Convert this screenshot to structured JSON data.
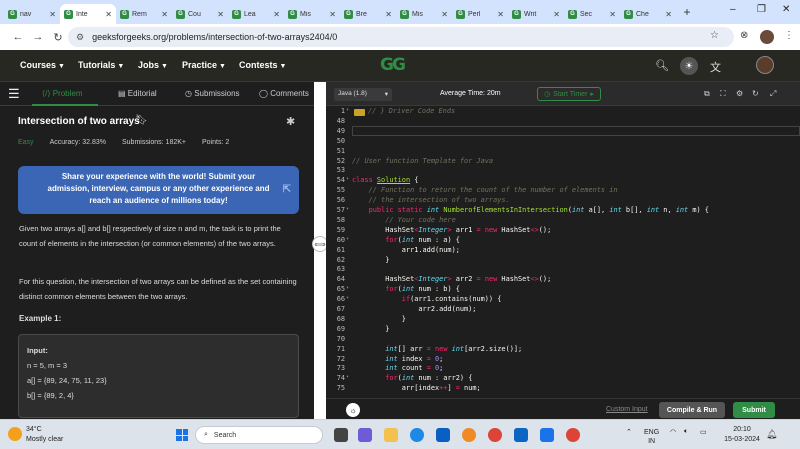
{
  "browser": {
    "tabs": [
      {
        "label": "nav"
      },
      {
        "label": "Inte",
        "active": true
      },
      {
        "label": "Rem"
      },
      {
        "label": "Cou"
      },
      {
        "label": "Lea"
      },
      {
        "label": "Mis"
      },
      {
        "label": "Bre"
      },
      {
        "label": "Mis"
      },
      {
        "label": "Perl"
      },
      {
        "label": "Writ"
      },
      {
        "label": "Sec"
      },
      {
        "label": "Che"
      }
    ],
    "url": "geeksforgeeks.org/problems/intersection-of-two-arrays2404/0"
  },
  "site_nav": {
    "items": [
      "Courses",
      "Tutorials",
      "Jobs",
      "Practice",
      "Contests"
    ],
    "logo": "GG"
  },
  "problem": {
    "tabs": [
      "Problem",
      "Editorial",
      "Submissions",
      "Comments"
    ],
    "title": "Intersection of two arrays",
    "difficulty": "Easy",
    "accuracy": "Accuracy: 32.83%",
    "submissions": "Submissions: 182K+",
    "points": "Points: 2",
    "banner": "Share your experience with the world! Submit your admission, interview, campus or any other experience and reach an audience of millions today!",
    "para1": "Given two arrays a[] and b[] respectively of size n and m, the task is to print the count of elements in the intersection (or common elements) of the two arrays.",
    "para2": "For this question, the intersection of two arrays can be defined as the set containing distinct common elements between the two arrays.",
    "example_heading": "Example 1:",
    "example": {
      "input_label": "Input:",
      "line1": "n = 5, m = 3",
      "line2": "a[] = {89, 24, 75, 11, 23}",
      "line3": "b[] = {89, 2, 4}"
    }
  },
  "editor": {
    "language": "Java (1.8)",
    "avg_time": "Average Time: 20m",
    "timer": "Start Timer",
    "lines": [
      {
        "n": "1",
        "fold": true,
        "html": "<span class='cm'>// } Driver Code Ends</span>"
      },
      {
        "n": "48",
        "html": ""
      },
      {
        "n": "49",
        "html": ""
      },
      {
        "n": "50",
        "html": ""
      },
      {
        "n": "51",
        "html": ""
      },
      {
        "n": "52",
        "html": "<span class='cm'>// User function Template for Java</span>"
      },
      {
        "n": "53",
        "html": ""
      },
      {
        "n": "54",
        "fold": true,
        "html": "<span class='kw'>class</span> <span class='cls'>Solution</span> {"
      },
      {
        "n": "55",
        "html": "    <span class='cm'>// Function to return the count of the number of elements in</span>"
      },
      {
        "n": "56",
        "html": "    <span class='cm'>// the intersection of two arrays.</span>"
      },
      {
        "n": "57",
        "fold": true,
        "html": "    <span class='kw'>public</span> <span class='kw'>static</span> <span class='ty'>int</span> <span class='fn'>NumberofElementsInIntersection</span>(<span class='ty'>int</span> a[], <span class='ty'>int</span> b[], <span class='ty'>int</span> n, <span class='ty'>int</span> m) {"
      },
      {
        "n": "58",
        "html": "        <span class='cm'>// Your code here</span>"
      },
      {
        "n": "59",
        "html": "        HashSet<span class='kw'>&lt;</span><span class='ty'>Integer</span><span class='kw'>&gt;</span> arr1 <span class='kw'>=</span> <span class='kw'>new</span> HashSet<span class='kw'>&lt;&gt;</span>();"
      },
      {
        "n": "60",
        "fold": true,
        "html": "        <span class='kw'>for</span>(<span class='ty'>int</span> num : a) {"
      },
      {
        "n": "61",
        "html": "            arr1.add(num);"
      },
      {
        "n": "62",
        "html": "        }"
      },
      {
        "n": "63",
        "html": ""
      },
      {
        "n": "64",
        "html": "        HashSet<span class='kw'>&lt;</span><span class='ty'>Integer</span><span class='kw'>&gt;</span> arr2 <span class='kw'>=</span> <span class='kw'>new</span> HashSet<span class='kw'>&lt;&gt;</span>();"
      },
      {
        "n": "65",
        "fold": true,
        "html": "        <span class='kw'>for</span>(<span class='ty'>int</span> num : b) {"
      },
      {
        "n": "66",
        "fold": true,
        "html": "            <span class='kw'>if</span>(arr1.contains(num)) {"
      },
      {
        "n": "67",
        "html": "                arr2.add(num);"
      },
      {
        "n": "68",
        "html": "            }"
      },
      {
        "n": "69",
        "html": "        }"
      },
      {
        "n": "70",
        "html": ""
      },
      {
        "n": "71",
        "html": "        <span class='ty'>int</span>[] arr <span class='kw'>=</span> <span class='kw'>new</span> <span class='ty'>int</span>[arr2.size()];"
      },
      {
        "n": "72",
        "html": "        <span class='ty'>int</span> index <span class='kw'>=</span> <span class='nm'>0</span>;"
      },
      {
        "n": "73",
        "html": "        <span class='ty'>int</span> count <span class='kw'>=</span> <span class='nm'>0</span>;"
      },
      {
        "n": "74",
        "fold": true,
        "html": "        <span class='kw'>for</span>(<span class='ty'>int</span> num : arr2) {"
      },
      {
        "n": "75",
        "html": "            arr[index<span class='kw'>++</span>] <span class='kw'>=</span> num;"
      }
    ],
    "custom_input": "Custom Input",
    "compile_run": "Compile & Run",
    "submit": "Submit"
  },
  "taskbar": {
    "temperature": "34°C",
    "weather": "Mostly clear",
    "search": "Search",
    "lang1": "ENG",
    "lang2": "IN",
    "time": "20:10",
    "date": "15-03-2024"
  },
  "colors": {
    "brand_green": "#2f8d46",
    "banner_blue": "#3b66b5",
    "editor_bg": "#1e1e1e"
  }
}
